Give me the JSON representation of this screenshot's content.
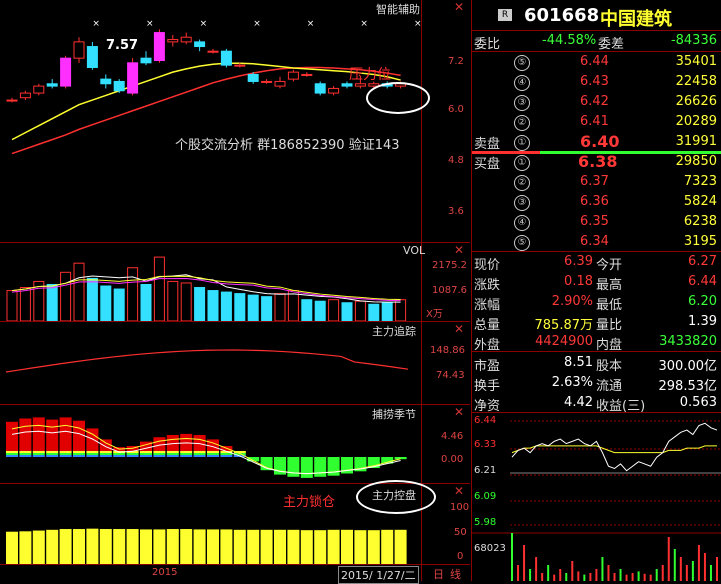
{
  "header": {
    "badge": "R",
    "code": "601668",
    "name": "中国建筑"
  },
  "main_chart": {
    "title": "智能辅助",
    "annotation": "7.57",
    "pressure_label": "压力位",
    "promo_text": "个股交流分析 群186852390 验证143",
    "y_labels": [
      "7.2",
      "6.0",
      "4.8",
      "3.6"
    ],
    "candles": [
      {
        "o": 6.05,
        "c": 6.05,
        "h": 6.1,
        "l": 6.0
      },
      {
        "o": 6.1,
        "c": 6.2,
        "h": 6.25,
        "l": 6.05
      },
      {
        "o": 6.2,
        "c": 6.35,
        "h": 6.4,
        "l": 6.15
      },
      {
        "o": 6.4,
        "c": 6.35,
        "h": 6.5,
        "l": 6.3
      },
      {
        "o": 6.35,
        "c": 6.95,
        "h": 7.0,
        "l": 6.3
      },
      {
        "o": 6.95,
        "c": 7.3,
        "h": 7.4,
        "l": 6.85
      },
      {
        "o": 7.2,
        "c": 6.75,
        "h": 7.3,
        "l": 6.7
      },
      {
        "o": 6.5,
        "c": 6.4,
        "h": 6.6,
        "l": 6.3
      },
      {
        "o": 6.45,
        "c": 6.25,
        "h": 6.5,
        "l": 6.2
      },
      {
        "o": 6.2,
        "c": 6.85,
        "h": 6.95,
        "l": 6.15
      },
      {
        "o": 6.95,
        "c": 6.85,
        "h": 7.1,
        "l": 6.8
      },
      {
        "o": 6.9,
        "c": 7.5,
        "h": 7.57,
        "l": 6.85
      },
      {
        "o": 7.3,
        "c": 7.35,
        "h": 7.45,
        "l": 7.2
      },
      {
        "o": 7.3,
        "c": 7.4,
        "h": 7.5,
        "l": 7.25
      },
      {
        "o": 7.3,
        "c": 7.2,
        "h": 7.35,
        "l": 7.1
      },
      {
        "o": 7.1,
        "c": 7.1,
        "h": 7.15,
        "l": 7.05
      },
      {
        "o": 7.1,
        "c": 6.8,
        "h": 7.15,
        "l": 6.75
      },
      {
        "o": 6.8,
        "c": 6.8,
        "h": 6.85,
        "l": 6.75
      },
      {
        "o": 6.6,
        "c": 6.45,
        "h": 6.65,
        "l": 6.4
      },
      {
        "o": 6.45,
        "c": 6.45,
        "h": 6.5,
        "l": 6.4
      },
      {
        "o": 6.35,
        "c": 6.45,
        "h": 6.55,
        "l": 6.3
      },
      {
        "o": 6.5,
        "c": 6.65,
        "h": 6.7,
        "l": 6.45
      },
      {
        "o": 6.6,
        "c": 6.6,
        "h": 6.65,
        "l": 6.55
      },
      {
        "o": 6.4,
        "c": 6.2,
        "h": 6.45,
        "l": 6.15
      },
      {
        "o": 6.2,
        "c": 6.3,
        "h": 6.35,
        "l": 6.15
      },
      {
        "o": 6.4,
        "c": 6.35,
        "h": 6.45,
        "l": 6.3
      },
      {
        "o": 6.35,
        "c": 6.4,
        "h": 6.55,
        "l": 6.3
      },
      {
        "o": 6.35,
        "c": 6.4,
        "h": 6.45,
        "l": 6.3
      },
      {
        "o": 6.4,
        "c": 6.35,
        "h": 6.45,
        "l": 6.3
      },
      {
        "o": 6.35,
        "c": 6.4,
        "h": 6.45,
        "l": 6.3
      }
    ],
    "ma_yellow": [
      5.2,
      5.35,
      5.5,
      5.65,
      5.8,
      5.95,
      6.05,
      6.15,
      6.25,
      6.35,
      6.45,
      6.55,
      6.65,
      6.72,
      6.78,
      6.82,
      6.84,
      6.84,
      6.83,
      6.8,
      6.77,
      6.74,
      6.72,
      6.7,
      6.68,
      6.66,
      6.63,
      6.6,
      6.55,
      6.48
    ],
    "ma_red": [
      4.9,
      5.0,
      5.1,
      5.2,
      5.3,
      5.42,
      5.52,
      5.62,
      5.72,
      5.82,
      5.92,
      6.02,
      6.12,
      6.22,
      6.32,
      6.42,
      6.5,
      6.57,
      6.63,
      6.68,
      6.72,
      6.74,
      6.75,
      6.75,
      6.74,
      6.72,
      6.7,
      6.67,
      6.63,
      6.58
    ],
    "ymin": 3.0,
    "ymax": 8.2
  },
  "vol_panel": {
    "title": "VOL",
    "y_labels": [
      "2175.2",
      "1087.6",
      "X万"
    ],
    "bars": [
      {
        "v": 1000,
        "up": true
      },
      {
        "v": 1100,
        "up": true
      },
      {
        "v": 1300,
        "up": true
      },
      {
        "v": 1200,
        "up": false
      },
      {
        "v": 1600,
        "up": true
      },
      {
        "v": 1900,
        "up": true
      },
      {
        "v": 1400,
        "up": false
      },
      {
        "v": 1150,
        "up": false
      },
      {
        "v": 1050,
        "up": false
      },
      {
        "v": 1750,
        "up": true
      },
      {
        "v": 1200,
        "up": false
      },
      {
        "v": 2100,
        "up": true
      },
      {
        "v": 1300,
        "up": true
      },
      {
        "v": 1250,
        "up": true
      },
      {
        "v": 1100,
        "up": false
      },
      {
        "v": 1000,
        "up": false
      },
      {
        "v": 950,
        "up": false
      },
      {
        "v": 900,
        "up": false
      },
      {
        "v": 850,
        "up": false
      },
      {
        "v": 800,
        "up": false
      },
      {
        "v": 900,
        "up": true
      },
      {
        "v": 1000,
        "up": true
      },
      {
        "v": 700,
        "up": false
      },
      {
        "v": 650,
        "up": false
      },
      {
        "v": 700,
        "up": true
      },
      {
        "v": 600,
        "up": false
      },
      {
        "v": 650,
        "up": true
      },
      {
        "v": 550,
        "up": false
      },
      {
        "v": 600,
        "up": false
      },
      {
        "v": 700,
        "up": true
      }
    ],
    "vmax": 2300
  },
  "main_track": {
    "title": "主力追踪",
    "y_labels": [
      "148.86",
      "74.43"
    ]
  },
  "season_panel": {
    "title": "捕捞季节",
    "y_labels": [
      "4.46",
      "0.00"
    ],
    "values": [
      3.2,
      3.5,
      3.6,
      3.4,
      3.6,
      3.3,
      2.6,
      1.6,
      0.9,
      1.0,
      1.4,
      1.8,
      2.0,
      2.1,
      2.0,
      1.6,
      1.0,
      0.4,
      -0.4,
      -1.2,
      -1.6,
      -1.8,
      -1.9,
      -1.8,
      -1.7,
      -1.5,
      -1.3,
      -1.0,
      -0.6,
      -0.2
    ]
  },
  "control_panel": {
    "title": "主力控盘",
    "lock_label": "主力锁仓",
    "y_labels": [
      "100",
      "50",
      "0"
    ],
    "values": [
      85,
      86,
      88,
      90,
      92,
      92,
      93,
      92,
      92,
      92,
      91,
      91,
      92,
      92,
      91,
      91,
      91,
      90,
      90,
      90,
      90,
      90,
      89,
      89,
      90,
      90,
      89,
      89,
      90,
      90
    ]
  },
  "bottom_bar": {
    "year": "2015",
    "date": "2015/ 1/27/二",
    "tab_day": "日",
    "tab_line": "线"
  },
  "quote": {
    "webi_label": "委比",
    "webi_value": "-44.58%",
    "weicha_label": "委差",
    "weicha_value": "-84336",
    "sell_label": "卖盘",
    "buy_label": "买盘",
    "sell": [
      {
        "n": "⑤",
        "price": "6.44",
        "vol": "35401"
      },
      {
        "n": "④",
        "price": "6.43",
        "vol": "22458"
      },
      {
        "n": "③",
        "price": "6.42",
        "vol": "26626"
      },
      {
        "n": "②",
        "price": "6.41",
        "vol": "20289"
      },
      {
        "n": "①",
        "price": "6.40",
        "vol": "31991"
      }
    ],
    "buy": [
      {
        "n": "①",
        "price": "6.38",
        "vol": "29850"
      },
      {
        "n": "②",
        "price": "6.37",
        "vol": "7323"
      },
      {
        "n": "③",
        "price": "6.36",
        "vol": "5824"
      },
      {
        "n": "④",
        "price": "6.35",
        "vol": "6238"
      },
      {
        "n": "⑤",
        "price": "6.34",
        "vol": "3195"
      }
    ],
    "stats": [
      {
        "l1": "现价",
        "v1": "6.39",
        "c1": "red",
        "l2": "今开",
        "v2": "6.27",
        "c2": "red"
      },
      {
        "l1": "涨跌",
        "v1": "0.18",
        "c1": "red",
        "l2": "最高",
        "v2": "6.44",
        "c2": "red"
      },
      {
        "l1": "涨幅",
        "v1": "2.90%",
        "c1": "red",
        "l2": "最低",
        "v2": "6.20",
        "c2": "grn"
      },
      {
        "l1": "总量",
        "v1": "785.87万",
        "c1": "yel",
        "l2": "量比",
        "v2": "1.39",
        "c2": "wht"
      },
      {
        "l1": "外盘",
        "v1": "4424900",
        "c1": "red",
        "l2": "内盘",
        "v2": "3433820",
        "c2": "grn"
      },
      {
        "l1": "市盈",
        "v1": "8.51",
        "c1": "wht",
        "l2": "股本",
        "v2": "300.00亿",
        "c2": "wht"
      },
      {
        "l1": "换手",
        "v1": "2.63%",
        "c1": "wht",
        "l2": "流通",
        "v2": "298.53亿",
        "c2": "wht"
      },
      {
        "l1": "净资",
        "v1": "4.42",
        "c1": "wht",
        "l2": "收益(三)",
        "v2": "0.563",
        "c2": "wht"
      }
    ]
  },
  "intraday": {
    "y_labels": [
      "6.44",
      "6.33",
      "6.21",
      "6.09",
      "5.98",
      "68023"
    ],
    "price": [
      6.28,
      6.31,
      6.32,
      6.3,
      6.33,
      6.34,
      6.33,
      6.35,
      6.36,
      6.34,
      6.35,
      6.36,
      6.34,
      6.33,
      6.35,
      6.3,
      6.24,
      6.23,
      6.25,
      6.22,
      6.24,
      6.26,
      6.25,
      6.24,
      6.28,
      6.3,
      6.35,
      6.37,
      6.39,
      6.4,
      6.38,
      6.42,
      6.43,
      6.41,
      6.4
    ],
    "avg": [
      6.3,
      6.31,
      6.32,
      6.32,
      6.33,
      6.33,
      6.33,
      6.33,
      6.33,
      6.33,
      6.33,
      6.33,
      6.33,
      6.33,
      6.33,
      6.32,
      6.31,
      6.3,
      6.3,
      6.3,
      6.3,
      6.3,
      6.3,
      6.3,
      6.3,
      6.3,
      6.31,
      6.31,
      6.31,
      6.32,
      6.32,
      6.32,
      6.33,
      6.33,
      6.33
    ],
    "vol": [
      60,
      20,
      45,
      15,
      30,
      10,
      20,
      8,
      15,
      10,
      25,
      12,
      8,
      10,
      15,
      30,
      20,
      10,
      15,
      8,
      10,
      12,
      9,
      8,
      15,
      20,
      55,
      40,
      30,
      20,
      25,
      45,
      35,
      20,
      30
    ]
  },
  "colors": {
    "up": "#ff3030",
    "down": "#33e0ff",
    "grid": "#8b0000",
    "yellow": "#ffff30",
    "green": "#30ff30"
  }
}
